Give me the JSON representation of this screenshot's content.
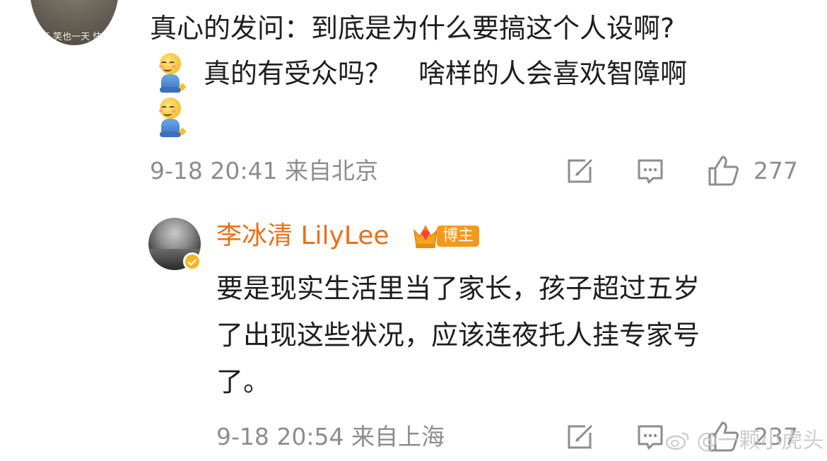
{
  "top_comment": {
    "avatar_caption": "天 笑也一天 快",
    "text_line1": "真心的发问：到底是为什么要搞这个人设啊?",
    "text_line2": "真的有受众吗？　啥样的人会喜欢智障啊",
    "emoji_name": "sitting-smile-emoji",
    "time": "9-18 20:41 来自北京",
    "likes": "277"
  },
  "reply": {
    "username": "李冰清 LilyLee",
    "badge_label": "博主",
    "text_line1": "要是现实生活里当了家长，孩子超过五岁",
    "text_line2": "了出现这些状况，应该连夜托人挂专家号",
    "text_line3": "了。",
    "time": "9-18 20:54 来自上海",
    "likes": "237"
  },
  "watermark": "@一颗小虎头",
  "colors": {
    "username": "#e8701a",
    "meta_gray": "#8d8d8d",
    "badge_bg": "#f39a1b",
    "verify_gold": "#f5b51d"
  },
  "icons": [
    "edit-icon",
    "comment-icon",
    "like-icon",
    "crown-badge-icon",
    "verified-icon"
  ]
}
